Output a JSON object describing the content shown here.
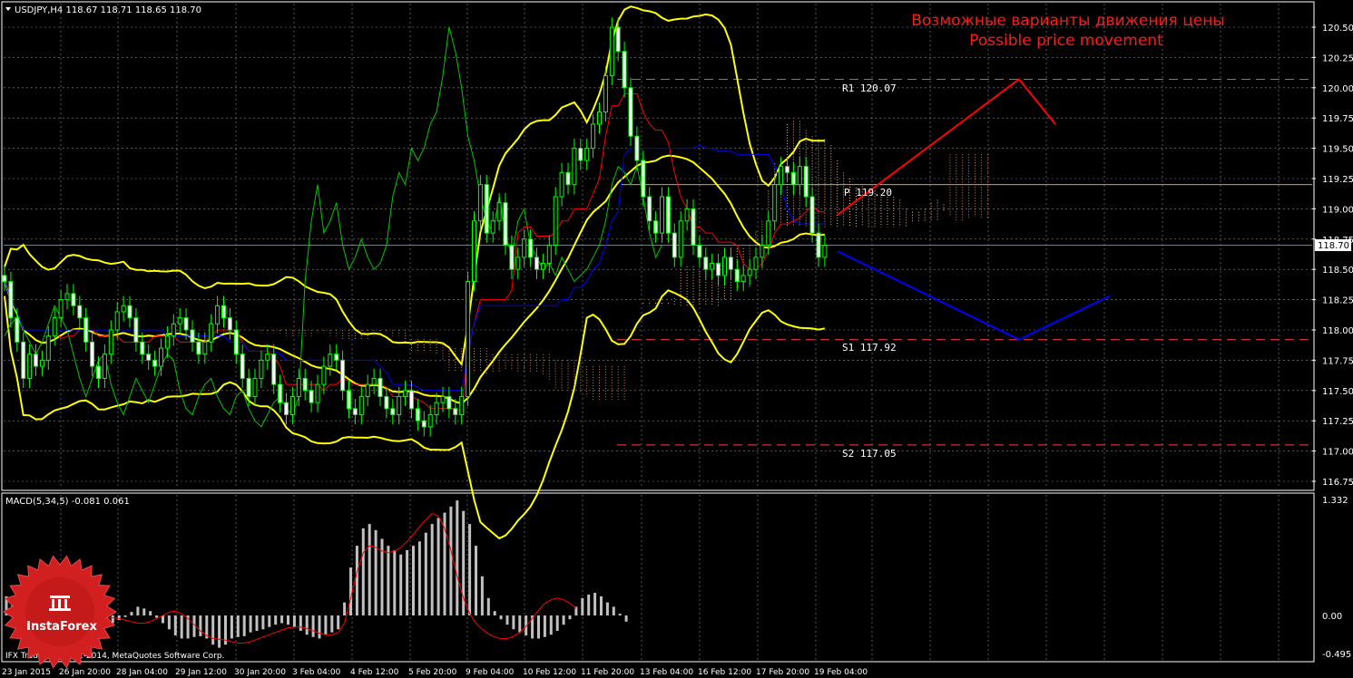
{
  "window": {
    "symbol_header": "USDJPY,H4  118.67 118.71 118.65 118.70",
    "macd_header": "MACD(5,34,5) -0.081 0.061",
    "copyright": "IFX Trader, © 2001-2014, MetaQuotes Software Corp."
  },
  "annotation": {
    "title_ru": "Возможные варианты движения цены",
    "title_en": "Possible price movement"
  },
  "brand": {
    "logo_text": "InstaForex"
  },
  "levels": {
    "r1": "R1 120.07",
    "p": "P 119.20",
    "s1": "S1 117.92",
    "s2": "S2 117.05",
    "current_price_tag": "118.70"
  },
  "colors": {
    "background": "#000000",
    "grid": "#8a8a8a",
    "candle": "#00ff00",
    "bands": "#ffff00",
    "tenkan": "#ff0000",
    "kijun": "#0000ff",
    "chikou": "#00c800",
    "macd_bars": "#c0c0c0",
    "macd_signal": "#ff0000",
    "level_line": "#ff4040",
    "pivot_line": "#d8b000",
    "forecast_up": "#ff0000",
    "forecast_down": "#0000ff"
  },
  "chart_data": [
    {
      "type": "candlestick",
      "title": "USDJPY,H4",
      "ohlc_last": {
        "open": 118.67,
        "high": 118.71,
        "low": 118.65,
        "close": 118.7
      },
      "x_ticks": [
        "23 Jan 2015",
        "26 Jan 20:00",
        "28 Jan 04:00",
        "29 Jan 12:00",
        "30 Jan 20:00",
        "3 Feb 04:00",
        "4 Feb 12:00",
        "5 Feb 20:00",
        "9 Feb 04:00",
        "10 Feb 12:00",
        "11 Feb 20:00",
        "13 Feb 04:00",
        "16 Feb 12:00",
        "17 Feb 20:00",
        "19 Feb 04:00"
      ],
      "y_ticks": [
        "120.50",
        "120.25",
        "120.00",
        "119.75",
        "119.50",
        "119.25",
        "119.00",
        "118.75",
        "118.50",
        "118.25",
        "118.00",
        "117.75",
        "117.50",
        "117.25",
        "117.00",
        "116.75"
      ],
      "ylim": [
        116.69,
        120.65
      ],
      "close": [
        118.4,
        118.1,
        117.9,
        117.6,
        117.8,
        117.7,
        117.75,
        117.95,
        118.1,
        118.25,
        118.3,
        118.2,
        118.1,
        117.9,
        117.7,
        117.6,
        117.8,
        118.0,
        118.15,
        118.2,
        118.1,
        117.9,
        117.8,
        117.75,
        117.7,
        117.85,
        117.95,
        118.05,
        118.1,
        118.0,
        117.9,
        117.8,
        117.9,
        118.05,
        118.2,
        118.1,
        118.0,
        117.8,
        117.6,
        117.45,
        117.6,
        117.75,
        117.8,
        117.55,
        117.4,
        117.3,
        117.45,
        117.6,
        117.5,
        117.4,
        117.55,
        117.7,
        117.8,
        117.75,
        117.5,
        117.35,
        117.3,
        117.45,
        117.55,
        117.6,
        117.45,
        117.35,
        117.3,
        117.45,
        117.5,
        117.35,
        117.25,
        117.2,
        117.3,
        117.4,
        117.45,
        117.35,
        117.3,
        117.45,
        118.4,
        118.9,
        119.2,
        118.8,
        118.9,
        119.05,
        118.7,
        118.5,
        118.6,
        118.75,
        118.6,
        118.5,
        118.55,
        118.7,
        119.1,
        119.3,
        119.2,
        119.5,
        119.4,
        119.5,
        119.7,
        119.8,
        120.1,
        120.5,
        120.3,
        120.0,
        119.6,
        119.4,
        119.1,
        118.9,
        118.8,
        119.1,
        118.8,
        118.6,
        118.9,
        119.0,
        118.7,
        118.6,
        118.5,
        118.55,
        118.45,
        118.6,
        118.5,
        118.4,
        118.45,
        118.5,
        118.6,
        118.7,
        118.9,
        119.2,
        119.35,
        119.3,
        119.2,
        119.35,
        119.1,
        118.8,
        118.6,
        118.7
      ],
      "resistance_support": [
        {
          "label": "R1",
          "value": 120.07
        },
        {
          "label": "P",
          "value": 119.2
        },
        {
          "label": "S1",
          "value": 117.92
        },
        {
          "label": "S2",
          "value": 117.05
        }
      ],
      "current_price": 118.7,
      "forecast": {
        "up_path": [
          [
            0,
            118.95
          ],
          [
            1,
            120.07
          ],
          [
            1.2,
            119.7
          ]
        ],
        "down_path": [
          [
            0,
            118.65
          ],
          [
            1,
            117.92
          ],
          [
            1.5,
            118.28
          ]
        ]
      }
    },
    {
      "type": "bar",
      "title": "MACD(5,34,5)",
      "main_value": -0.081,
      "signal_value": 0.061,
      "y_ticks": [
        "1.332",
        "0.00",
        "-0.495"
      ],
      "ylim": [
        -0.495,
        1.332
      ],
      "values": [
        0.22,
        0.18,
        0.12,
        0.05,
        -0.05,
        -0.08,
        -0.1,
        -0.12,
        -0.1,
        -0.06,
        -0.03,
        0.0,
        0.02,
        -0.02,
        -0.06,
        -0.1,
        -0.12,
        -0.1,
        -0.06,
        -0.02,
        0.04,
        0.1,
        0.08,
        0.05,
        -0.03,
        -0.1,
        -0.18,
        -0.26,
        -0.3,
        -0.3,
        -0.28,
        -0.27,
        -0.3,
        -0.38,
        -0.42,
        -0.38,
        -0.3,
        -0.28,
        -0.27,
        -0.22,
        -0.2,
        -0.18,
        -0.15,
        -0.12,
        -0.1,
        -0.12,
        -0.15,
        -0.2,
        -0.25,
        -0.28,
        -0.3,
        -0.25,
        -0.22,
        -0.18,
        0.15,
        0.55,
        0.8,
        1.0,
        1.05,
        0.98,
        0.88,
        0.8,
        0.75,
        0.7,
        0.75,
        0.8,
        0.85,
        0.95,
        1.05,
        1.12,
        1.18,
        1.25,
        1.32,
        1.2,
        1.05,
        0.8,
        0.45,
        0.2,
        0.05,
        -0.05,
        -0.12,
        -0.18,
        -0.22,
        -0.26,
        -0.3,
        -0.3,
        -0.28,
        -0.25,
        -0.2,
        -0.12,
        -0.05,
        0.1,
        0.2,
        0.24,
        0.26,
        0.22,
        0.15,
        0.1,
        0.02,
        -0.08
      ],
      "signal": [
        0.28,
        0.22,
        0.12,
        0.02,
        -0.06,
        -0.1,
        -0.12,
        -0.12,
        -0.1,
        -0.07,
        -0.04,
        -0.03,
        -0.04,
        -0.06,
        -0.08,
        -0.1,
        -0.1,
        -0.08,
        -0.04,
        0.0,
        0.04,
        0.05,
        0.02,
        -0.04,
        -0.12,
        -0.2,
        -0.26,
        -0.3,
        -0.31,
        -0.32,
        -0.34,
        -0.36,
        -0.36,
        -0.34,
        -0.31,
        -0.28,
        -0.25,
        -0.22,
        -0.19,
        -0.16,
        -0.15,
        -0.15,
        -0.17,
        -0.2,
        -0.23,
        -0.25,
        -0.25,
        -0.22,
        -0.1,
        0.2,
        0.5,
        0.72,
        0.8,
        0.78,
        0.74,
        0.72,
        0.74,
        0.78,
        0.85,
        0.93,
        1.02,
        1.1,
        1.17,
        1.14,
        1.0,
        0.75,
        0.45,
        0.2,
        0.02,
        -0.1,
        -0.18,
        -0.24,
        -0.28,
        -0.3,
        -0.3,
        -0.27,
        -0.22,
        -0.14,
        -0.04,
        0.06,
        0.14,
        0.18,
        0.2,
        0.18,
        0.14,
        0.08
      ]
    }
  ]
}
